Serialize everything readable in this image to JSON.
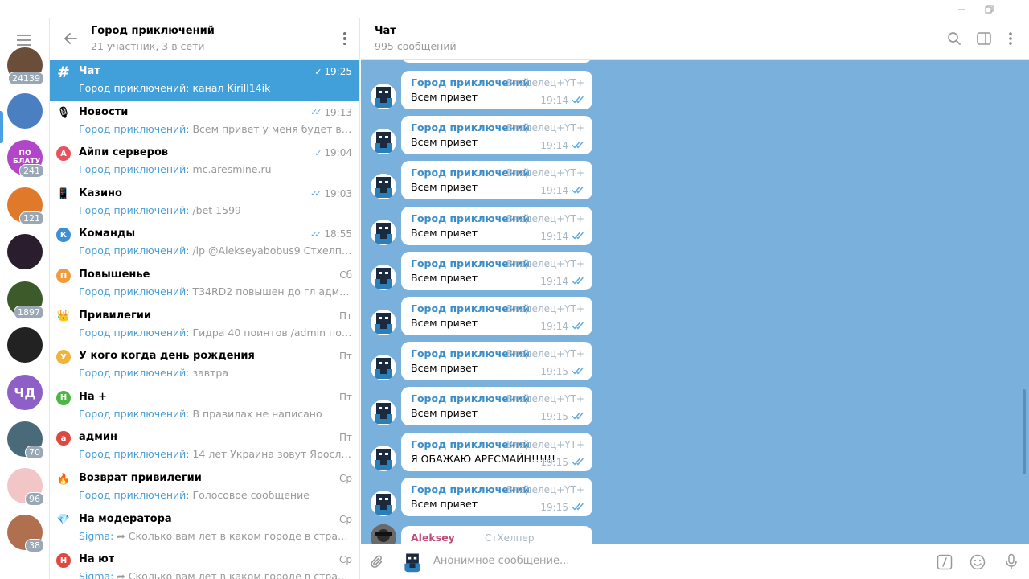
{
  "window": {
    "minimize_icon": "minimize-icon",
    "restore_icon": "restore-icon"
  },
  "rail": {
    "items": [
      {
        "badge": "24139",
        "color": "#6a4e3a"
      },
      {
        "badge": "",
        "color": "#4a7fc1"
      },
      {
        "badge": "241",
        "color": "#b146c8",
        "label": "ПО БЛАТУ"
      },
      {
        "badge": "121",
        "color": "#e07a2a"
      },
      {
        "badge": "",
        "color": "#2a1e2e"
      },
      {
        "badge": "1897",
        "color": "#3c5a2a"
      },
      {
        "badge": "",
        "color": "#222222"
      },
      {
        "badge": "",
        "color": "#8e5fc6",
        "label": "ЧД"
      },
      {
        "badge": "70",
        "color": "#4a6a7a"
      },
      {
        "badge": "96",
        "color": "#f2c6c6"
      },
      {
        "badge": "38",
        "color": "#b07050"
      }
    ]
  },
  "list": {
    "title": "Город приключений",
    "subtitle": "21 участник, 3 в сети",
    "topics": [
      {
        "name": "Чат",
        "time": "19:25",
        "sender": "Город приключений:",
        "preview": " канал Kirill14ik",
        "icon": "#",
        "icon_color": "#419fd9",
        "check": "✓"
      },
      {
        "name": "Новости",
        "time": "19:13",
        "sender": "Город приключений:",
        "preview": " Всем привет у меня будет видео на ютубе",
        "icon": "🎙",
        "icon_color": "#ffffff",
        "check": "✓✓"
      },
      {
        "name": "Айпи серверов",
        "time": "19:04",
        "sender": "Город приключений:",
        "preview": " mc.aresmine.ru",
        "icon": "А",
        "icon_color": "#e8515e",
        "check": "✓"
      },
      {
        "name": "Казино",
        "time": "19:03",
        "sender": "Город приключений:",
        "preview": " /bet 1599",
        "icon": "📱",
        "icon_color": "#ffffff",
        "check": "✓✓"
      },
      {
        "name": "Команды",
        "time": "18:55",
        "sender": "Город приключений:",
        "preview": " /lp @Alekseyabobus9 Стхелпер con",
        "icon": "К",
        "icon_color": "#3a8fd8",
        "check": "✓✓"
      },
      {
        "name": "Повышенье",
        "time": "Сб",
        "sender": "Город приключений:",
        "preview": " T34RD2  повышен до гл админа",
        "icon": "П",
        "icon_color": "#f19b3b",
        "check": ""
      },
      {
        "name": "Привилегии",
        "time": "Пт",
        "sender": "Город приключений:",
        "preview": " Гидра 40 поинтов /admin позвать админа",
        "icon": "👑",
        "icon_color": "#ffffff",
        "check": ""
      },
      {
        "name": "У кого когда день рождения",
        "time": "Пт",
        "sender": "Город приключений:",
        "preview": " завтра",
        "icon": "У",
        "icon_color": "#f1b43b",
        "check": ""
      },
      {
        "name": "На +",
        "time": "Пт",
        "sender": "Город приключений:",
        "preview": " В правилах не написано",
        "icon": "Н",
        "icon_color": "#4cb844",
        "check": ""
      },
      {
        "name": "админ",
        "time": "Пт",
        "sender": "Город приключений:",
        "preview": " 14 лет Украина зовут Ярослав не знаю",
        "icon": "а",
        "icon_color": "#e0473e",
        "check": ""
      },
      {
        "name": "Возврат привилегии",
        "time": "Ср",
        "sender": "Город приключений:",
        "preview": " Голосовое сообщение",
        "icon": "🔥",
        "icon_color": "#ffffff",
        "check": ""
      },
      {
        "name": "На модератора",
        "time": "Ср",
        "sender": "Sigma:",
        "preview": " ➦ Сколько вам лет в каком городе в стране вы проживаете",
        "icon": "💎",
        "icon_color": "#ffffff",
        "check": ""
      },
      {
        "name": "На ют",
        "time": "Ср",
        "sender": "Sigma:",
        "preview": " ➦ Сколько вам лет в каком городе в стране вы проживаете",
        "icon": "Н",
        "icon_color": "#e0473e",
        "check": ""
      }
    ]
  },
  "chat": {
    "title": "Чат",
    "subtitle": "995 сообщений",
    "messages": [
      {
        "name": "Город приключений",
        "role": "Владелец+YT+",
        "text": "Всем привет",
        "time": "19:14"
      },
      {
        "name": "Город приключений",
        "role": "Владелец+YT+",
        "text": "Всем привет",
        "time": "19:14"
      },
      {
        "name": "Город приключений",
        "role": "Владелец+YT+",
        "text": "Всем привет",
        "time": "19:14"
      },
      {
        "name": "Город приключений",
        "role": "Владелец+YT+",
        "text": "Всем привет",
        "time": "19:14"
      },
      {
        "name": "Город приключений",
        "role": "Владелец+YT+",
        "text": "Всем привет",
        "time": "19:14"
      },
      {
        "name": "Город приключений",
        "role": "Владелец+YT+",
        "text": "Всем привет",
        "time": "19:14"
      },
      {
        "name": "Город приключений",
        "role": "Владелец+YT+",
        "text": "Всем привет",
        "time": "19:15"
      },
      {
        "name": "Город приключений",
        "role": "Владелец+YT+",
        "text": "Всем привет",
        "time": "19:15"
      },
      {
        "name": "Город приключений",
        "role": "Владелец+YT+",
        "text": "Я ОБАЖАЮ АРЕСМАЙН!!!!!!",
        "time": "19:15"
      },
      {
        "name": "Город приключений",
        "role": "Владелец+YT+",
        "text": "Всем привет",
        "time": "19:15"
      }
    ],
    "last": {
      "name": "Aleksey",
      "role": "СтХелпер"
    }
  },
  "composer": {
    "placeholder": "Анонимное сообщение..."
  },
  "colors": {
    "accent": "#419fd9",
    "chat_bg": "#79b1dc",
    "sender_name": "#3a8dc9",
    "aleksey_name": "#c04a7a"
  }
}
